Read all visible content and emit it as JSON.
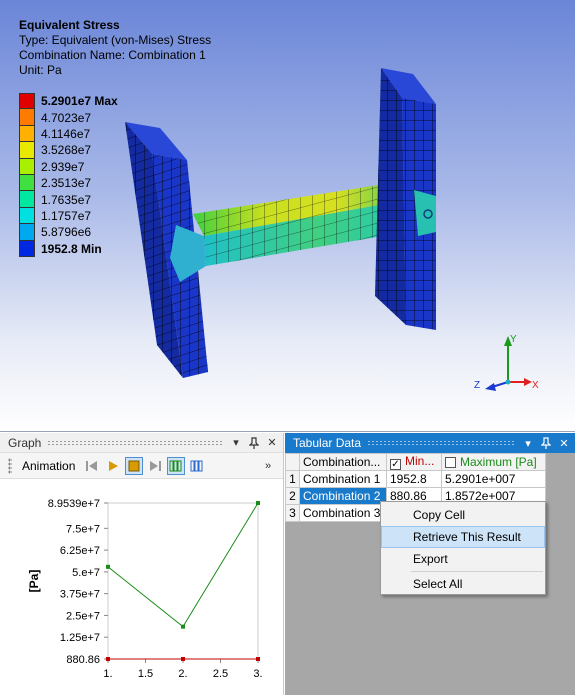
{
  "viewport": {
    "title": "Equivalent Stress",
    "type_line": "Type: Equivalent (von-Mises) Stress",
    "combination_line": "Combination Name: Combination 1",
    "unit_line": "Unit: Pa",
    "legend": [
      {
        "label": "5.2901e7 Max",
        "color": "#e00000",
        "bold": true
      },
      {
        "label": "4.7023e7",
        "color": "#ff7a00"
      },
      {
        "label": "4.1146e7",
        "color": "#ffb000"
      },
      {
        "label": "3.5268e7",
        "color": "#e8e800"
      },
      {
        "label": "2.939e7",
        "color": "#a8f000"
      },
      {
        "label": "2.3513e7",
        "color": "#40e040"
      },
      {
        "label": "1.7635e7",
        "color": "#00e8a0"
      },
      {
        "label": "1.1757e7",
        "color": "#00e0e0"
      },
      {
        "label": "5.8796e6",
        "color": "#00a8f0"
      },
      {
        "label": "1952.8 Min",
        "color": "#0028e0",
        "bold": true
      }
    ],
    "axes": {
      "x": "X",
      "y": "Y",
      "z": "Z"
    }
  },
  "graph": {
    "panel_title": "Graph",
    "animation_label": "Animation"
  },
  "chart_data": {
    "type": "line",
    "x": [
      1,
      2,
      3
    ],
    "series": [
      {
        "values": [
          52901000,
          18572000,
          89539000
        ],
        "color": "#1a8c1a"
      },
      {
        "values": [
          880.86,
          880.86,
          880.86
        ],
        "color": "#c00000"
      }
    ],
    "ylabel": "[Pa]",
    "xlim": [
      1,
      3
    ],
    "ylim": [
      880.86,
      89539000
    ],
    "xticks": [
      "1.",
      "1.5",
      "2.",
      "2.5",
      "3."
    ],
    "yticks": [
      {
        "v": 89539000,
        "label": "8.9539e+7"
      },
      {
        "v": 75000000,
        "label": "7.5e+7"
      },
      {
        "v": 62500000,
        "label": "6.25e+7"
      },
      {
        "v": 50000000,
        "label": "5.e+7"
      },
      {
        "v": 37500000,
        "label": "3.75e+7"
      },
      {
        "v": 25000000,
        "label": "2.5e+7"
      },
      {
        "v": 12500000,
        "label": "1.25e+7"
      },
      {
        "v": 880.86,
        "label": "880.86"
      }
    ]
  },
  "tabular": {
    "panel_title": "Tabular Data",
    "headers": [
      "Combination...",
      "Min...",
      "Maximum [Pa]"
    ],
    "header_colors": {
      "min": "#c00000",
      "max": "#1a8c1a"
    },
    "rows": [
      {
        "n": "1",
        "name": "Combination 1",
        "min": "1952.8",
        "max": "5.2901e+007"
      },
      {
        "n": "2",
        "name": "Combination 2",
        "min": "880.86",
        "max": "1.8572e+007"
      },
      {
        "n": "3",
        "name": "Combination 3",
        "min": "",
        "max": ""
      }
    ]
  },
  "context_menu": {
    "items": [
      "Copy Cell",
      "Retrieve This Result",
      "Export",
      "Select All"
    ]
  }
}
